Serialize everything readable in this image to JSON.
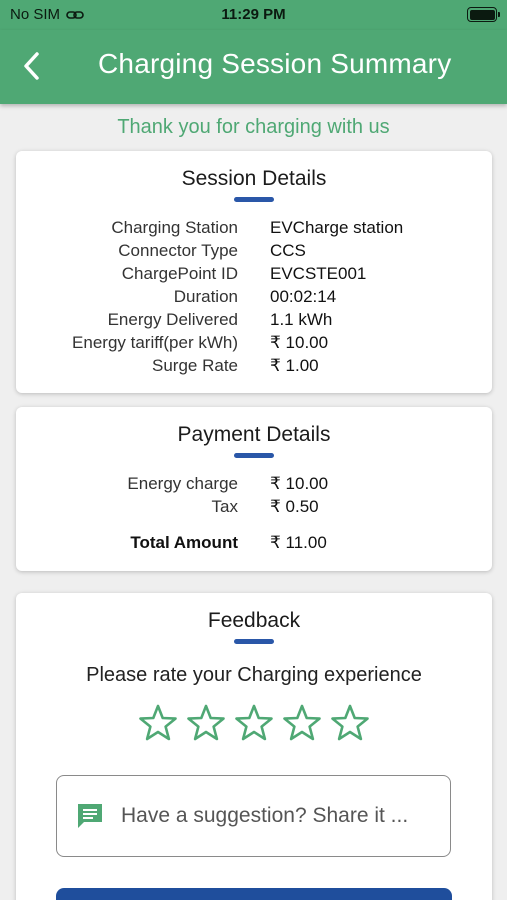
{
  "status_bar": {
    "carrier": "No SIM",
    "time": "11:29 PM"
  },
  "app_bar": {
    "title": "Charging Session Summary",
    "back_icon": "chevron-left-icon"
  },
  "thanks_message": "Thank you for charging with us",
  "session_details": {
    "title": "Session Details",
    "rows": [
      {
        "label": "Charging Station",
        "value": "EVCharge station"
      },
      {
        "label": "Connector Type",
        "value": "CCS"
      },
      {
        "label": "ChargePoint ID",
        "value": "EVCSTE001"
      },
      {
        "label": "Duration",
        "value": "00:02:14"
      },
      {
        "label": "Energy Delivered",
        "value": "1.1 kWh"
      },
      {
        "label": "Energy tariff(per kWh)",
        "value": "₹ 10.00"
      },
      {
        "label": "Surge Rate",
        "value": "₹ 1.00"
      }
    ]
  },
  "payment_details": {
    "title": "Payment Details",
    "rows": [
      {
        "label": "Energy charge",
        "value": "₹ 10.00"
      },
      {
        "label": "Tax",
        "value": "₹ 0.50"
      }
    ],
    "total": {
      "label": "Total Amount",
      "value": "₹ 11.00"
    }
  },
  "feedback": {
    "title": "Feedback",
    "prompt": "Please rate your Charging experience",
    "rating": {
      "value": 0,
      "max": 5
    },
    "suggestion_placeholder": "Have a suggestion? Share it ...",
    "suggestion_icon": "message-icon"
  },
  "colors": {
    "primary_green": "#4fa874",
    "accent_blue": "#2a57a8",
    "button_blue": "#1f4e9c"
  }
}
